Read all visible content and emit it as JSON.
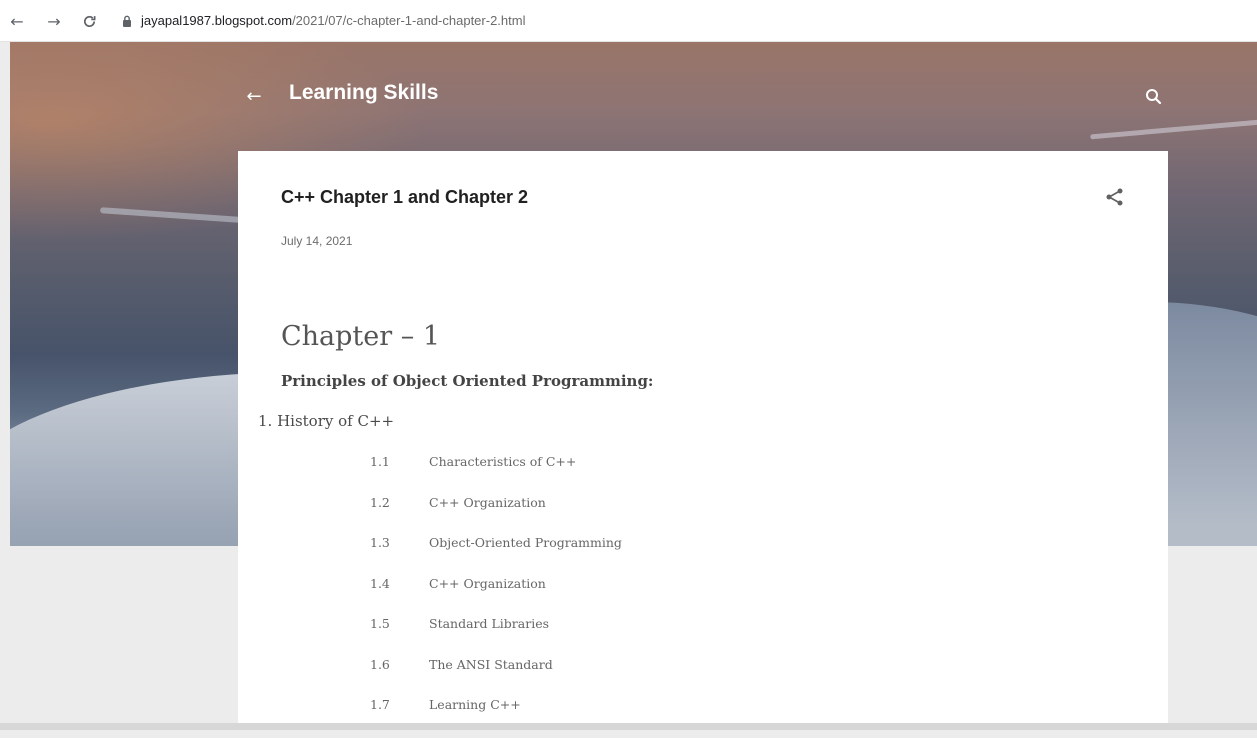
{
  "browser": {
    "url_host": "jayapal1987.blogspot.com",
    "url_path": "/2021/07/c-chapter-1-and-chapter-2.html"
  },
  "header": {
    "blog_title": "Learning Skills"
  },
  "post": {
    "title": "C++ Chapter 1 and Chapter 2",
    "date": "July 14, 2021",
    "chapter_heading": "Chapter – 1",
    "subheading": "Principles of Object Oriented Programming:",
    "section": "1. History of C++",
    "items": [
      {
        "num": "1.1",
        "label": "Characteristics of C++"
      },
      {
        "num": "1.2",
        "label": "C++ Organization"
      },
      {
        "num": "1.3",
        "label": "Object-Oriented Programming"
      },
      {
        "num": "1.4",
        "label": "C++ Organization"
      },
      {
        "num": "1.5",
        "label": "Standard Libraries"
      },
      {
        "num": "1.6",
        "label": "The ANSI Standard"
      },
      {
        "num": "1.7",
        "label": "Learning C++"
      }
    ]
  }
}
